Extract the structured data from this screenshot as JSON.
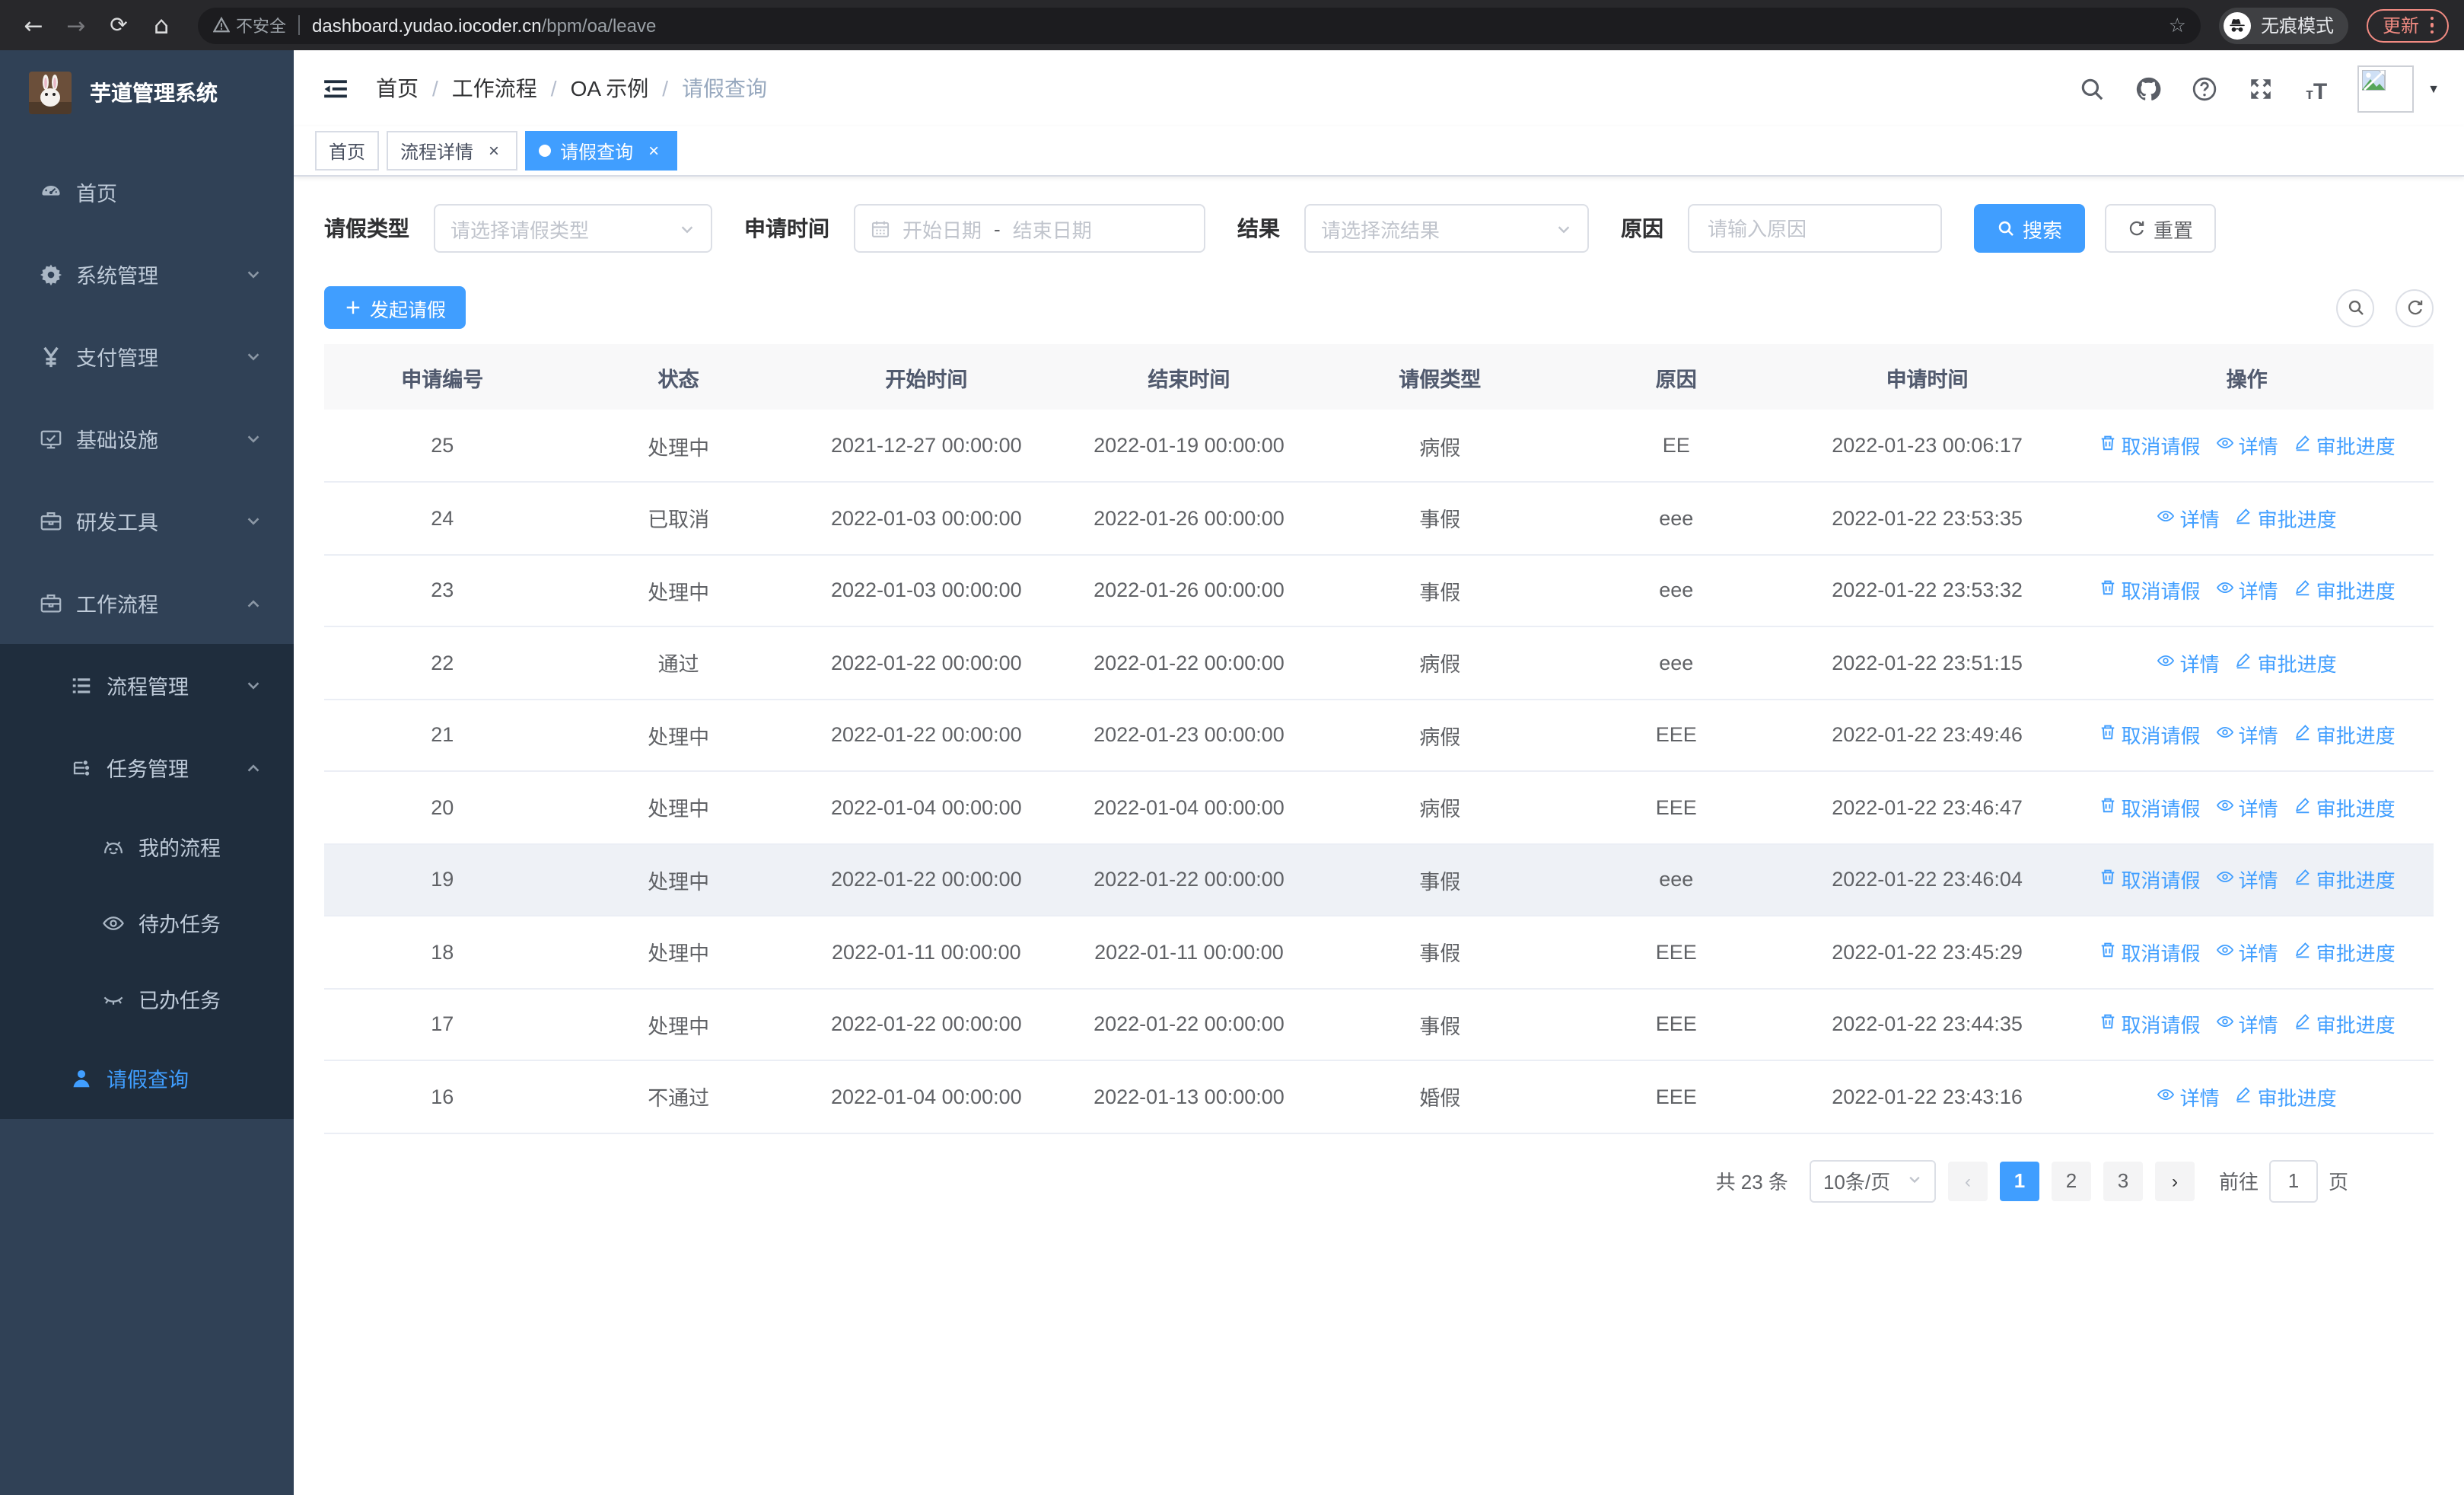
{
  "colors": {
    "primary": "#409eff",
    "sidebar_bg": "#304156",
    "submenu_bg": "#1f2d3d",
    "update_accent": "#f28b82"
  },
  "browser": {
    "security_label": "不安全",
    "url_host": "dashboard.yudao.iocoder.cn",
    "url_path": "/bpm/oa/leave",
    "incognito_label": "无痕模式",
    "update_label": "更新"
  },
  "sidebar": {
    "title": "芋道管理系统",
    "menu": [
      {
        "label": "首页",
        "icon": "dashboard-icon",
        "level": 1
      },
      {
        "label": "系统管理",
        "icon": "gear-icon",
        "level": 1,
        "chevron": "down"
      },
      {
        "label": "支付管理",
        "icon": "yen-icon",
        "level": 1,
        "chevron": "down"
      },
      {
        "label": "基础设施",
        "icon": "monitor-icon",
        "level": 1,
        "chevron": "down"
      },
      {
        "label": "研发工具",
        "icon": "toolbox-icon",
        "level": 1,
        "chevron": "down"
      },
      {
        "label": "工作流程",
        "icon": "toolbox-icon",
        "level": 1,
        "chevron": "up"
      },
      {
        "label": "流程管理",
        "icon": "list-icon",
        "level": 2,
        "chevron": "down",
        "in_submenu": true
      },
      {
        "label": "任务管理",
        "icon": "flow-icon",
        "level": 2,
        "chevron": "up",
        "in_submenu": true
      },
      {
        "label": "我的流程",
        "icon": "robot-icon",
        "level": 3,
        "in_submenu": true
      },
      {
        "label": "待办任务",
        "icon": "eye-icon",
        "level": 3,
        "in_submenu": true
      },
      {
        "label": "已办任务",
        "icon": "eye-closed-icon",
        "level": 3,
        "in_submenu": true
      },
      {
        "label": "请假查询",
        "icon": "user-icon",
        "level": 2,
        "active": true,
        "in_submenu": true
      }
    ]
  },
  "navbar": {
    "breadcrumb": [
      "首页",
      "工作流程",
      "OA 示例",
      "请假查询"
    ],
    "right_icons": [
      "search-icon",
      "github-icon",
      "question-icon",
      "fullscreen-icon",
      "font-size-icon"
    ]
  },
  "tabs": [
    {
      "label": "首页",
      "closable": false,
      "active": false
    },
    {
      "label": "流程详情",
      "closable": true,
      "active": false
    },
    {
      "label": "请假查询",
      "closable": true,
      "active": true
    }
  ],
  "filter": {
    "fields": [
      {
        "label": "请假类型",
        "type": "select",
        "placeholder": "请选择请假类型"
      },
      {
        "label": "申请时间",
        "type": "daterange",
        "start_placeholder": "开始日期",
        "separator": "-",
        "end_placeholder": "结束日期"
      },
      {
        "label": "结果",
        "type": "select",
        "placeholder": "请选择流结果"
      },
      {
        "label": "原因",
        "type": "input",
        "placeholder": "请输入原因"
      }
    ],
    "search_label": "搜索",
    "reset_label": "重置"
  },
  "toolbar": {
    "create_label": "发起请假"
  },
  "table": {
    "columns": [
      "申请编号",
      "状态",
      "开始时间",
      "结束时间",
      "请假类型",
      "原因",
      "申请时间",
      "操作"
    ],
    "action_labels": {
      "cancel": "取消请假",
      "detail": "详情",
      "progress": "审批进度"
    },
    "highlighted_row_id": "19",
    "rows": [
      {
        "id": "25",
        "status": "处理中",
        "start": "2021-12-27 00:00:00",
        "end": "2022-01-19 00:00:00",
        "type": "病假",
        "reason": "EE",
        "applied": "2022-01-23 00:06:17",
        "actions": [
          "cancel",
          "detail",
          "progress"
        ]
      },
      {
        "id": "24",
        "status": "已取消",
        "start": "2022-01-03 00:00:00",
        "end": "2022-01-26 00:00:00",
        "type": "事假",
        "reason": "eee",
        "applied": "2022-01-22 23:53:35",
        "actions": [
          "detail",
          "progress"
        ]
      },
      {
        "id": "23",
        "status": "处理中",
        "start": "2022-01-03 00:00:00",
        "end": "2022-01-26 00:00:00",
        "type": "事假",
        "reason": "eee",
        "applied": "2022-01-22 23:53:32",
        "actions": [
          "cancel",
          "detail",
          "progress"
        ]
      },
      {
        "id": "22",
        "status": "通过",
        "start": "2022-01-22 00:00:00",
        "end": "2022-01-22 00:00:00",
        "type": "病假",
        "reason": "eee",
        "applied": "2022-01-22 23:51:15",
        "actions": [
          "detail",
          "progress"
        ]
      },
      {
        "id": "21",
        "status": "处理中",
        "start": "2022-01-22 00:00:00",
        "end": "2022-01-23 00:00:00",
        "type": "病假",
        "reason": "EEE",
        "applied": "2022-01-22 23:49:46",
        "actions": [
          "cancel",
          "detail",
          "progress"
        ]
      },
      {
        "id": "20",
        "status": "处理中",
        "start": "2022-01-04 00:00:00",
        "end": "2022-01-04 00:00:00",
        "type": "病假",
        "reason": "EEE",
        "applied": "2022-01-22 23:46:47",
        "actions": [
          "cancel",
          "detail",
          "progress"
        ]
      },
      {
        "id": "19",
        "status": "处理中",
        "start": "2022-01-22 00:00:00",
        "end": "2022-01-22 00:00:00",
        "type": "事假",
        "reason": "eee",
        "applied": "2022-01-22 23:46:04",
        "actions": [
          "cancel",
          "detail",
          "progress"
        ]
      },
      {
        "id": "18",
        "status": "处理中",
        "start": "2022-01-11 00:00:00",
        "end": "2022-01-11 00:00:00",
        "type": "事假",
        "reason": "EEE",
        "applied": "2022-01-22 23:45:29",
        "actions": [
          "cancel",
          "detail",
          "progress"
        ]
      },
      {
        "id": "17",
        "status": "处理中",
        "start": "2022-01-22 00:00:00",
        "end": "2022-01-22 00:00:00",
        "type": "事假",
        "reason": "EEE",
        "applied": "2022-01-22 23:44:35",
        "actions": [
          "cancel",
          "detail",
          "progress"
        ]
      },
      {
        "id": "16",
        "status": "不通过",
        "start": "2022-01-04 00:00:00",
        "end": "2022-01-13 00:00:00",
        "type": "婚假",
        "reason": "EEE",
        "applied": "2022-01-22 23:43:16",
        "actions": [
          "detail",
          "progress"
        ]
      }
    ]
  },
  "pagination": {
    "total_label": "共 23 条",
    "page_size_label": "10条/页",
    "pages": [
      "1",
      "2",
      "3"
    ],
    "active_page": "1",
    "goto_label": "前往",
    "goto_value": "1",
    "unit_label": "页"
  }
}
